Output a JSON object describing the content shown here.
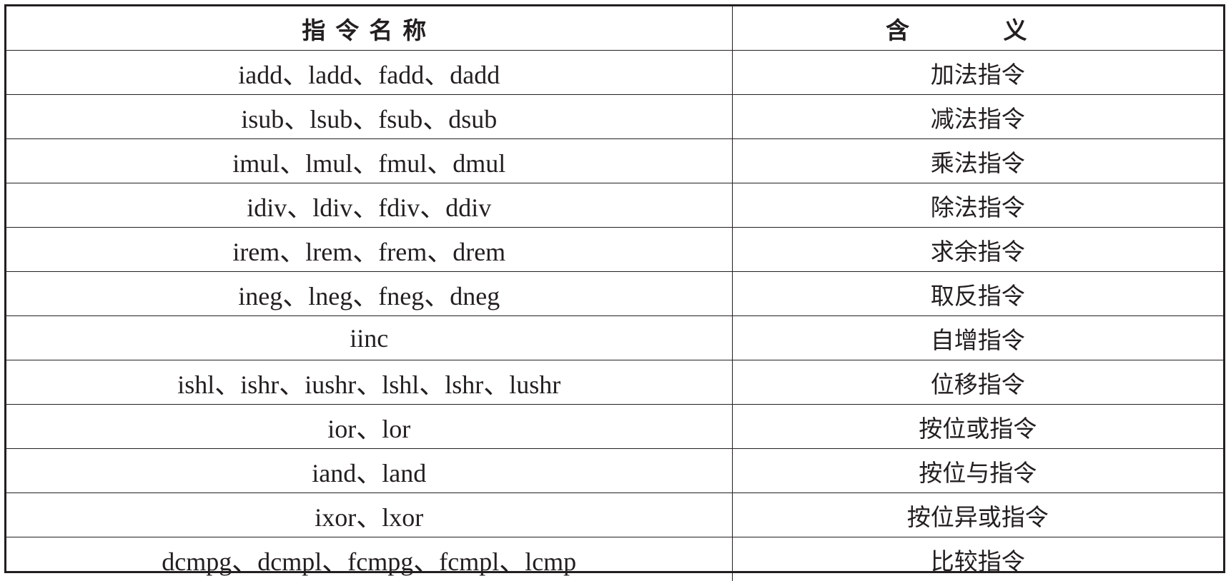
{
  "headers": {
    "name": "指令名称",
    "meaning": "含 义"
  },
  "rows": [
    {
      "name": "iadd、ladd、fadd、dadd",
      "meaning": "加法指令"
    },
    {
      "name": "isub、lsub、fsub、dsub",
      "meaning": "减法指令"
    },
    {
      "name": "imul、lmul、fmul、dmul",
      "meaning": "乘法指令"
    },
    {
      "name": "idiv、ldiv、fdiv、ddiv",
      "meaning": "除法指令"
    },
    {
      "name": "irem、lrem、frem、drem",
      "meaning": "求余指令"
    },
    {
      "name": "ineg、lneg、fneg、dneg",
      "meaning": "取反指令"
    },
    {
      "name": "iinc",
      "meaning": "自增指令"
    },
    {
      "name": "ishl、ishr、iushr、lshl、lshr、lushr",
      "meaning": "位移指令"
    },
    {
      "name": "ior、lor",
      "meaning": "按位或指令"
    },
    {
      "name": "iand、land",
      "meaning": "按位与指令"
    },
    {
      "name": "ixor、lxor",
      "meaning": "按位异或指令"
    },
    {
      "name": "dcmpg、dcmpl、fcmpg、fcmpl、lcmp",
      "meaning": "比较指令"
    }
  ]
}
